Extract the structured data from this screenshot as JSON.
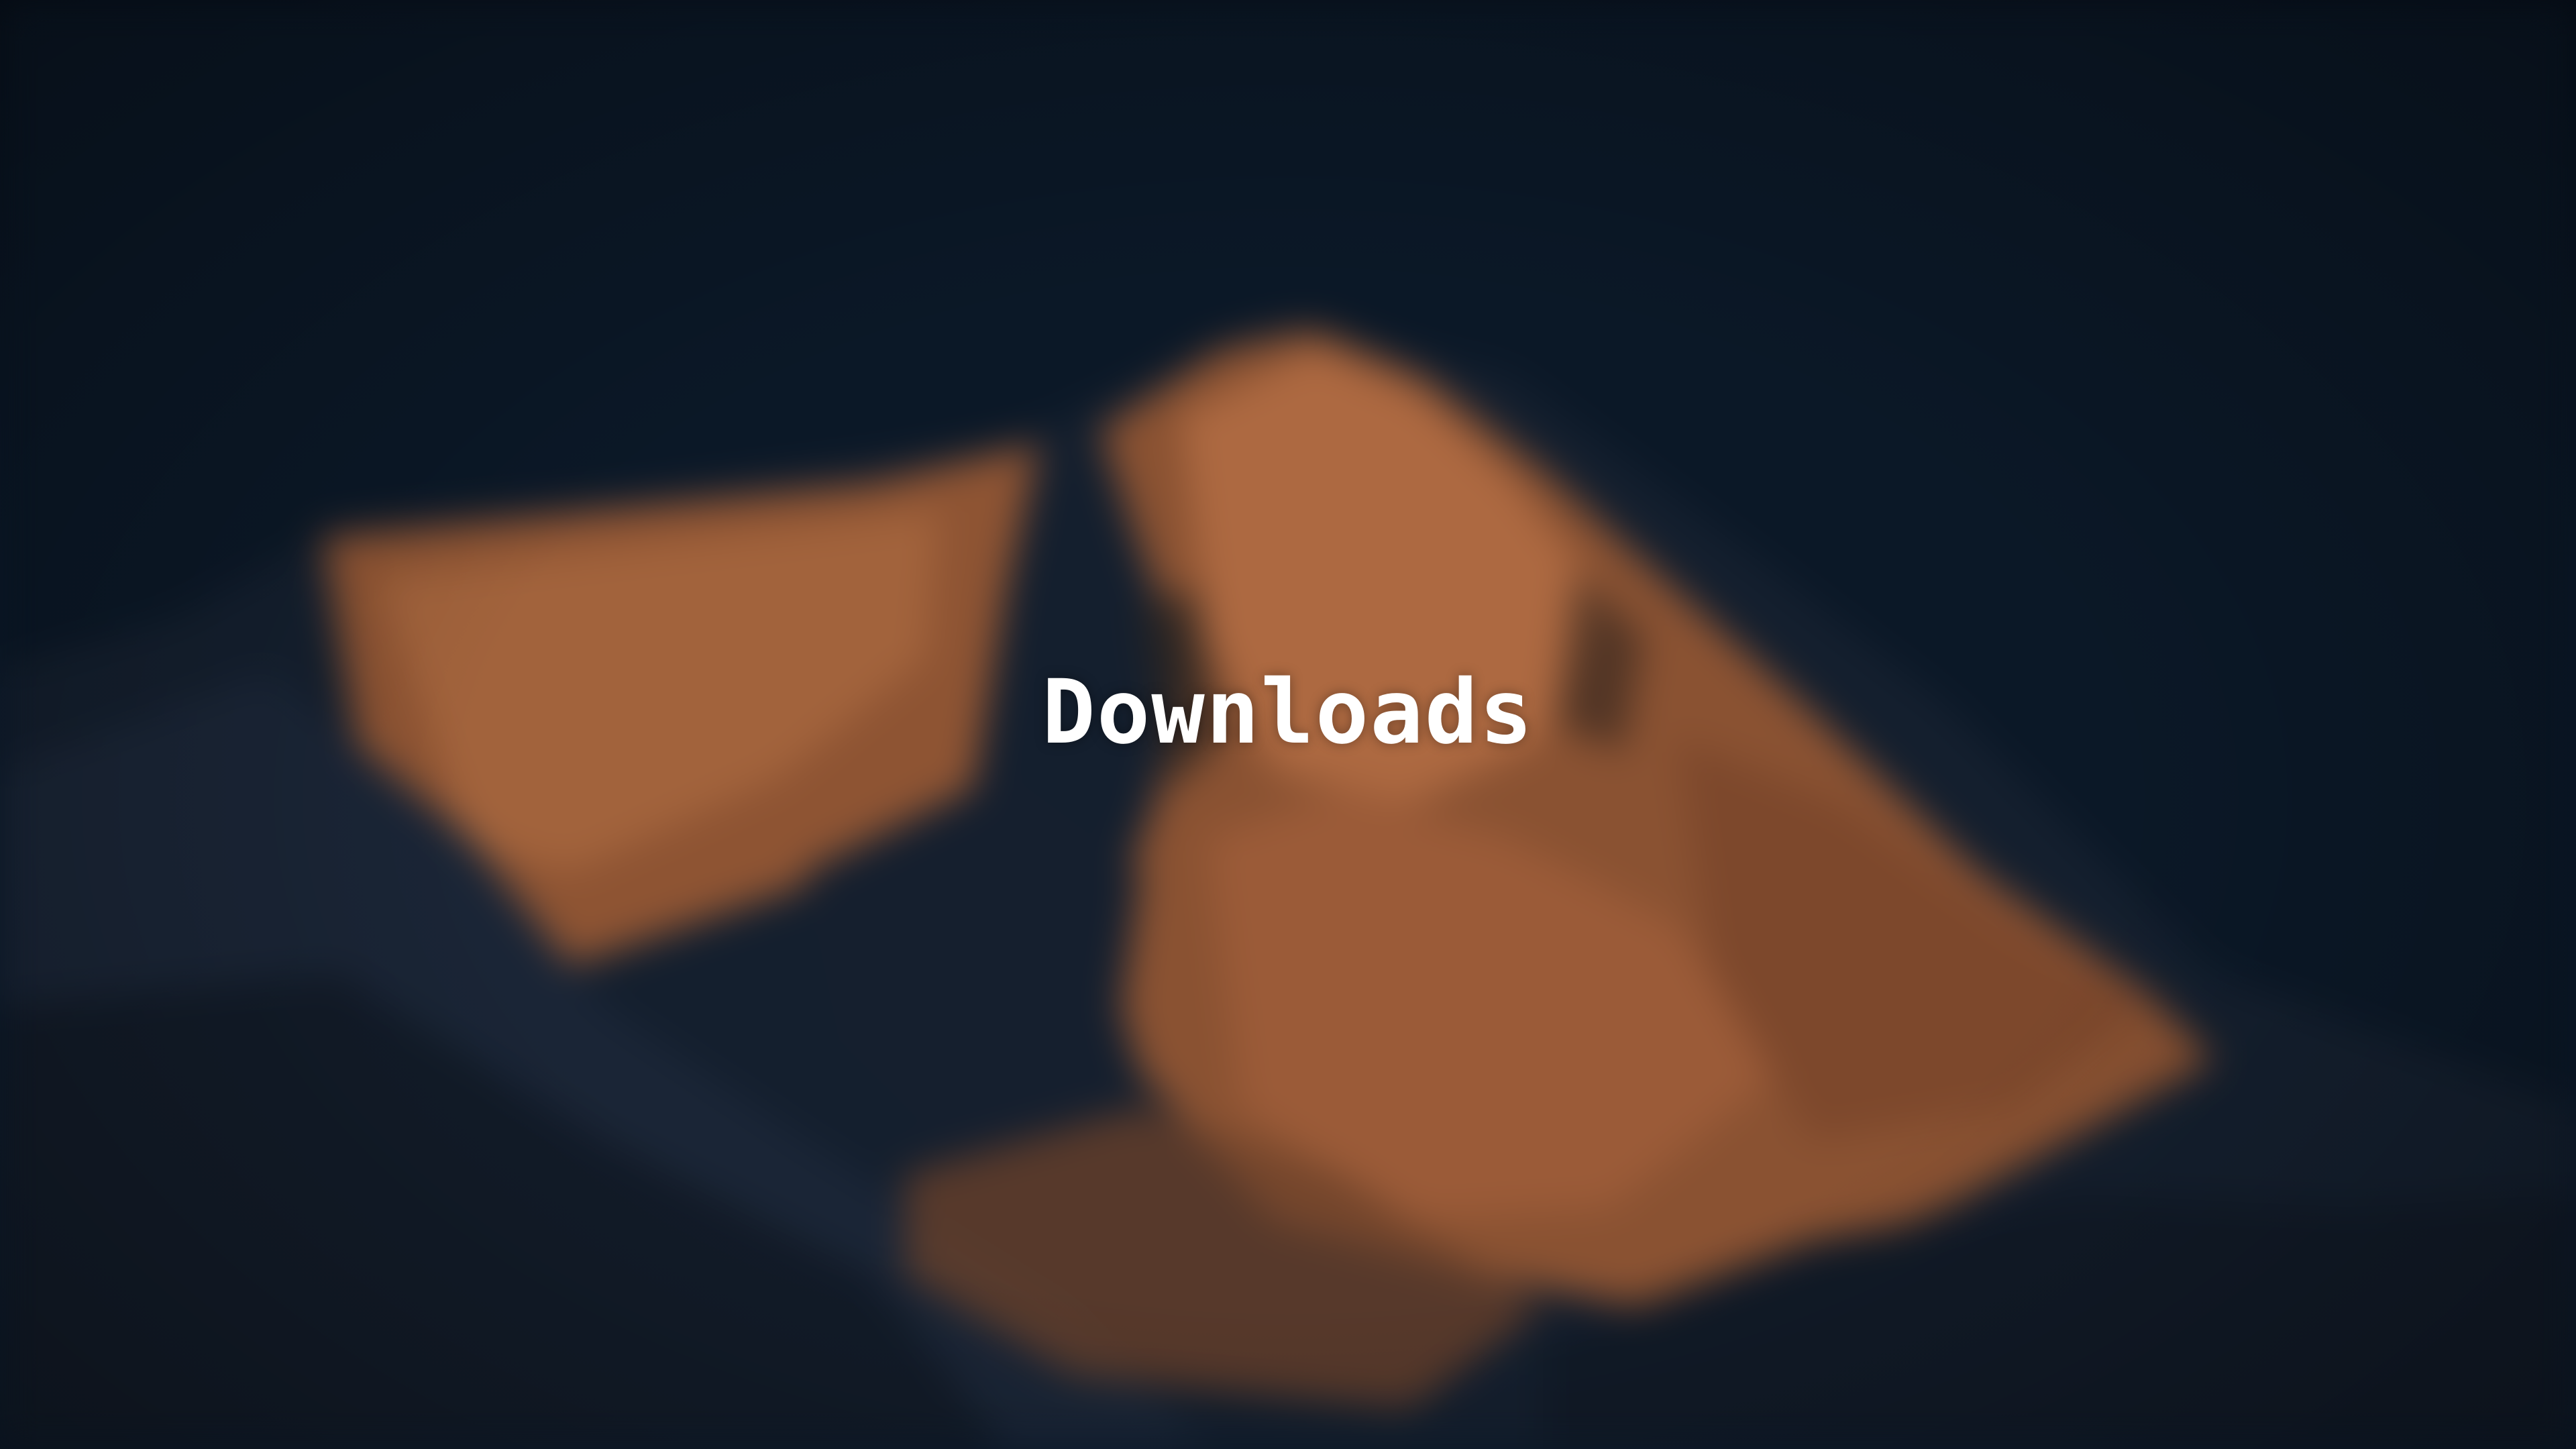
{
  "desktop": {
    "title": "Downloads",
    "wallpaper": {
      "subject": "mountain-peak-at-dusk",
      "colors": {
        "sky": "#0a1626",
        "rock_lit": "#9a5a37",
        "rock_highlight": "#c07a4c",
        "shadow": "#121c2a",
        "snow_shadow": "#1f2b3c"
      }
    }
  }
}
